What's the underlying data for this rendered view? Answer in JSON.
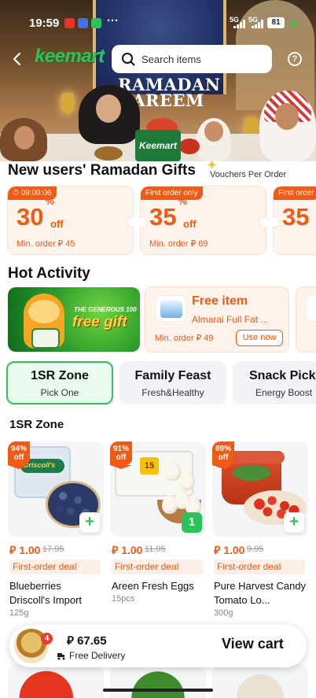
{
  "status_bar": {
    "time": "19:59",
    "network1": "5G",
    "network2": "5G",
    "battery": "81",
    "more": "···"
  },
  "header": {
    "logo": "keemart",
    "search_placeholder": "Search items"
  },
  "hero": {
    "banner_title_line1": "RAMADAN",
    "banner_title_line2": "KAREEM",
    "bag_brand": "Keemart"
  },
  "new_users": {
    "title": "New users' Ramadan Gifts",
    "note": "Vouchers Per Order",
    "coupons": [
      {
        "tag": "09:00:06",
        "percent": "30",
        "unit": "%",
        "off": "off",
        "min": "Min. order ⃁ 45"
      },
      {
        "tag": "First order only",
        "percent": "35",
        "unit": "%",
        "off": "off",
        "min": "Min. order ⃁ 69"
      },
      {
        "tag": "First order",
        "percent": "35",
        "unit": "",
        "off": "",
        "min": ""
      }
    ]
  },
  "hot_activity": {
    "title": "Hot Activity",
    "banner_line1": "THE GENEROUS 100",
    "banner_line2": "free gift",
    "free_item": {
      "title": "Free item",
      "name": "Almarai Full Fat ...",
      "min": "Min. order ⃁ 49",
      "button": "Use now"
    }
  },
  "zones": [
    {
      "title": "1SR Zone",
      "subtitle": "Pick One",
      "active": true
    },
    {
      "title": "Family Feast",
      "subtitle": "Fresh&Healthy",
      "active": false
    },
    {
      "title": "Snack Pick",
      "subtitle": "Energy Boost",
      "active": false
    }
  ],
  "section": {
    "title": "1SR Zone"
  },
  "products": [
    {
      "discount_pct": "94%",
      "discount_off": "off",
      "price": "⃁ 1.00",
      "old_price": "17.95",
      "deal": "First-order deal",
      "name": "Blueberries Driscoll's Import",
      "qty": "125g",
      "cart_qty": null
    },
    {
      "discount_pct": "91%",
      "discount_off": "off",
      "price": "⃁ 1.00",
      "old_price": "11.95",
      "deal": "First-order deal",
      "name": "Areen Fresh Eggs",
      "qty": "15pcs",
      "cart_qty": "1"
    },
    {
      "discount_pct": "89%",
      "discount_off": "off",
      "price": "⃁ 1.00",
      "old_price": "9.95",
      "deal": "First-order deal",
      "name": "Pure Harvest Candy Tomato Lo...",
      "qty": "300g",
      "cart_qty": null
    }
  ],
  "cart": {
    "badge": "4",
    "total": "⃁ 67.65",
    "delivery": "Free Delivery",
    "button": "View cart"
  },
  "colors": {
    "accent_green": "#2bc35a",
    "accent_orange": "#f05a12"
  }
}
